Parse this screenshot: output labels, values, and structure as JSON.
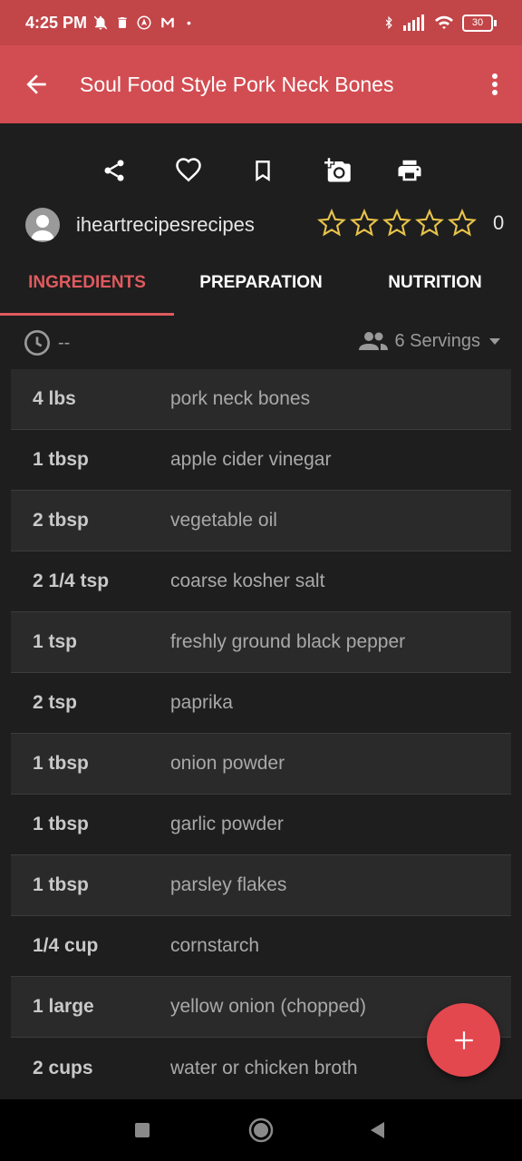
{
  "status_bar": {
    "time": "4:25 PM",
    "battery": "30"
  },
  "app_bar": {
    "title": "Soul Food Style Pork Neck Bones"
  },
  "author": {
    "name": "iheartrecipesrecipes"
  },
  "rating": {
    "stars": 0,
    "max": 5,
    "count": "0"
  },
  "tabs": [
    {
      "label": "INGREDIENTS",
      "active": true
    },
    {
      "label": "PREPARATION",
      "active": false
    },
    {
      "label": "NUTRITION",
      "active": false
    }
  ],
  "meta": {
    "time": "--",
    "servings": "6 Servings"
  },
  "ingredients": [
    {
      "qty": "4 lbs",
      "item": "pork neck bones"
    },
    {
      "qty": "1 tbsp",
      "item": "apple cider vinegar"
    },
    {
      "qty": "2 tbsp",
      "item": "vegetable oil"
    },
    {
      "qty": "2 1/4 tsp",
      "item": "coarse kosher salt"
    },
    {
      "qty": "1 tsp",
      "item": "freshly ground black pepper"
    },
    {
      "qty": "2 tsp",
      "item": "paprika"
    },
    {
      "qty": "1 tbsp",
      "item": "onion powder"
    },
    {
      "qty": "1 tbsp",
      "item": "garlic powder"
    },
    {
      "qty": "1 tbsp",
      "item": "parsley flakes"
    },
    {
      "qty": "1/4 cup",
      "item": "cornstarch"
    },
    {
      "qty": "1 large",
      "item": "yellow onion (chopped)"
    },
    {
      "qty": "2 cups",
      "item": "water or chicken broth"
    }
  ],
  "colors": {
    "accent": "#d24d52",
    "star": "#e8c34a",
    "fab": "#e3484e"
  }
}
